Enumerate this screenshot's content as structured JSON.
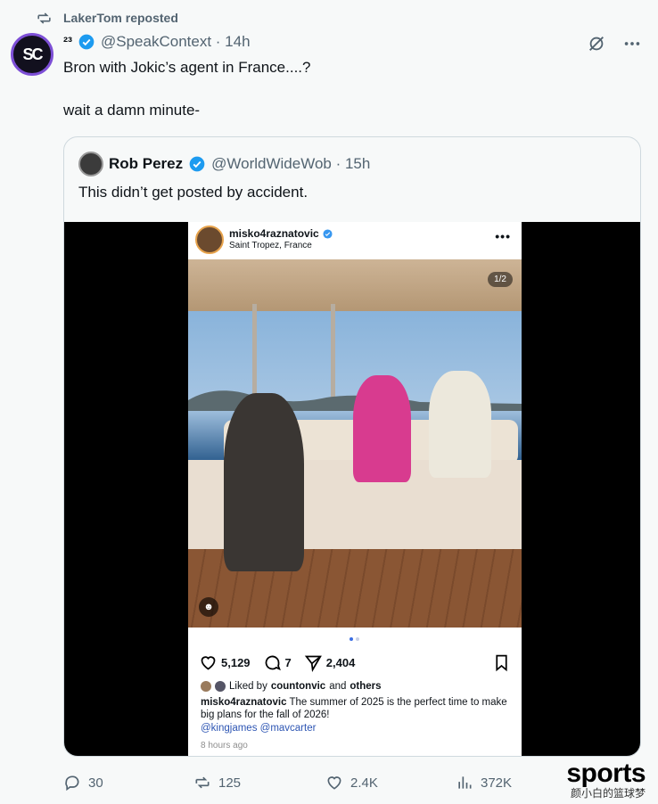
{
  "repost": {
    "label": "LakerTom reposted",
    "icon": "repost-icon"
  },
  "tweet": {
    "avatar_text": "SC",
    "author_name": "²³",
    "handle_time": "@SpeakContext · 14h",
    "text": "Bron with Jokic’s agent in France....?\n\nwait a damn minute-"
  },
  "quote": {
    "author_name": "Rob Perez",
    "handle_time": "@WorldWideWob · 15h",
    "text": "This didn’t get posted by accident."
  },
  "instagram": {
    "username": "misko4raznatovic",
    "location": "Saint Tropez, France",
    "more": "•••",
    "counter": "1/2",
    "likes": "5,129",
    "comments": "7",
    "shares": "2,404",
    "liked_by_prefix": "Liked by",
    "liked_by_user": "countonvic",
    "liked_by_and": "and",
    "liked_by_others": "others",
    "caption_user": "misko4raznatovic",
    "caption_text": "The summer of 2025 is the perfect time to make big plans for the fall of 2026!",
    "mentions": "@kingjames @mavcarter",
    "time_ago": "8 hours ago"
  },
  "actions": {
    "replies": "30",
    "reposts": "125",
    "likes": "2.4K",
    "views": "372K"
  },
  "watermark": {
    "big": "sports",
    "small": "颜小白的篮球梦"
  },
  "colors": {
    "verified": "#1d9bf0",
    "muted": "#536471",
    "border": "#cfd9de",
    "link": "#2d55b3"
  }
}
